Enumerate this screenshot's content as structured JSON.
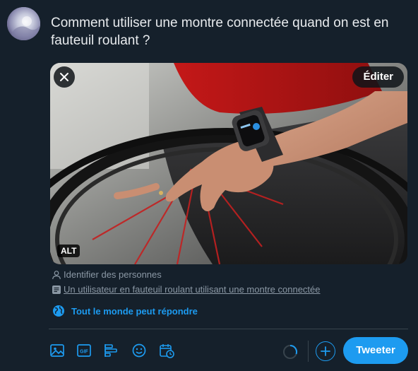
{
  "composer": {
    "text": "Comment utiliser une montre connectée quand on est en fauteuil roulant ?"
  },
  "media": {
    "edit_label": "Éditer",
    "alt_badge": "ALT",
    "remove_icon": "close-icon"
  },
  "media_meta": {
    "tag_people_label": "Identifier des personnes",
    "tag_people_icon": "person-icon",
    "description": "Un utilisateur en fauteuil roulant utilisant une montre connectée",
    "description_icon": "description-icon"
  },
  "reply_settings": {
    "label": "Tout le monde peut répondre",
    "icon": "globe-icon"
  },
  "toolbar": {
    "icons": [
      "image-icon",
      "gif-icon",
      "poll-icon",
      "emoji-icon",
      "schedule-icon"
    ],
    "gif_text": "GIF",
    "add_icon": "plus-icon",
    "tweet_label": "Tweeter"
  },
  "colors": {
    "background": "#15202b",
    "accent": "#1d9bf0",
    "text": "#e8ebee",
    "muted": "#8b98a5",
    "divider": "#38444d"
  }
}
